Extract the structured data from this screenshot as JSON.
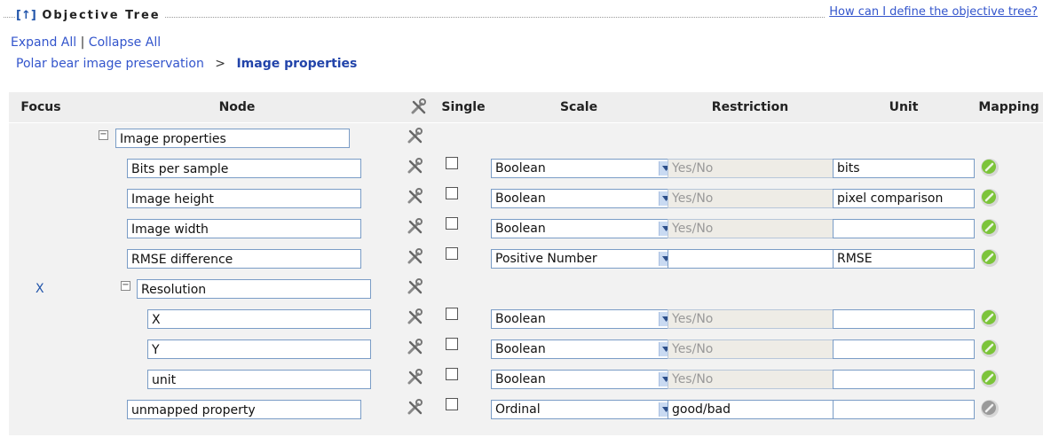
{
  "header": {
    "legend_arrow": "[↑]",
    "legend_title": "Objective Tree",
    "help_link": "How can I define the objective tree?"
  },
  "links": {
    "expand_all": "Expand All",
    "separator": "|",
    "collapse_all": "Collapse All"
  },
  "breadcrumb": {
    "parent": "Polar bear image preservation",
    "separator": ">",
    "current": "Image properties"
  },
  "columns": {
    "focus": "Focus",
    "node": "Node",
    "single": "Single",
    "scale": "Scale",
    "restriction": "Restriction",
    "unit": "Unit",
    "mapping": "Mapping"
  },
  "rows": [
    {
      "focus": "",
      "node": "Image properties",
      "group": true
    },
    {
      "focus": "",
      "node": "Bits per sample",
      "scale": "Boolean",
      "restriction": "Yes/No",
      "unit": "bits",
      "mapped": true
    },
    {
      "focus": "",
      "node": "Image height",
      "scale": "Boolean",
      "restriction": "Yes/No",
      "unit": "pixel comparison",
      "mapped": true
    },
    {
      "focus": "",
      "node": "Image width",
      "scale": "Boolean",
      "restriction": "Yes/No",
      "unit": "",
      "mapped": true
    },
    {
      "focus": "",
      "node": "RMSE difference",
      "scale": "Positive Number",
      "restriction": "",
      "unit": "RMSE",
      "mapped": true
    },
    {
      "focus": "X",
      "node": "Resolution",
      "group": true
    },
    {
      "focus": "",
      "node": "X",
      "scale": "Boolean",
      "restriction": "Yes/No",
      "unit": "",
      "mapped": true
    },
    {
      "focus": "",
      "node": "Y",
      "scale": "Boolean",
      "restriction": "Yes/No",
      "unit": "",
      "mapped": true
    },
    {
      "focus": "",
      "node": "unit",
      "scale": "Boolean",
      "restriction": "Yes/No",
      "unit": "",
      "mapped": true
    },
    {
      "focus": "",
      "node": "unmapped property",
      "scale": "Ordinal",
      "restriction": "good/bad",
      "unit": "",
      "mapped": false
    }
  ],
  "colors": {
    "link": "#3355cc",
    "mapped": "#7cc43a",
    "unmapped": "#9a9a9a"
  },
  "icons": {
    "tool": "tools-icon",
    "mapping": "mapping-pin-icon",
    "collapse": "minus-box-icon"
  }
}
